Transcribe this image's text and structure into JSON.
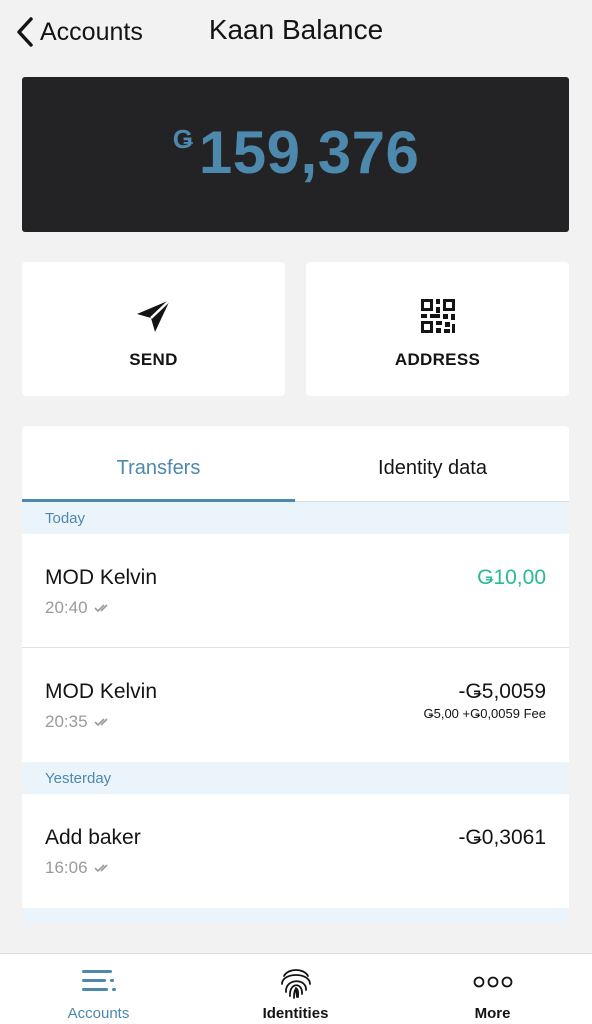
{
  "header": {
    "back_label": "Accounts",
    "title": "Kaan Balance"
  },
  "balance": {
    "symbol": "Ǥ",
    "amount": "159,376"
  },
  "actions": {
    "send_label": "SEND",
    "address_label": "ADDRESS"
  },
  "tabs": {
    "active": "Transfers",
    "inactive": "Identity data"
  },
  "sections": {
    "today": "Today",
    "yesterday": "Yesterday"
  },
  "transactions": [
    {
      "name": "MOD Kelvin",
      "time": "20:40",
      "amount": "Ǥ10,00"
    },
    {
      "name": "MOD Kelvin",
      "time": "20:35",
      "amount": "-Ǥ5,0059",
      "fee": "Ǥ5,00 +Ǥ0,0059 Fee"
    },
    {
      "name": "Add baker",
      "time": "16:06",
      "amount": "-Ǥ0,3061"
    }
  ],
  "nav": {
    "accounts": "Accounts",
    "identities": "Identities",
    "more": "More"
  },
  "colors": {
    "accent": "#4d88ad",
    "positive": "#27b999",
    "card_dark": "#232325",
    "section_bg": "#ecf4fb"
  },
  "icons": {
    "back": "chevron-left-icon",
    "send": "paper-plane-icon",
    "address": "qr-code-icon",
    "read_receipt": "double-check-icon",
    "accounts": "list-lines-icon",
    "identities": "fingerprint-icon",
    "more": "three-dots-icon"
  }
}
